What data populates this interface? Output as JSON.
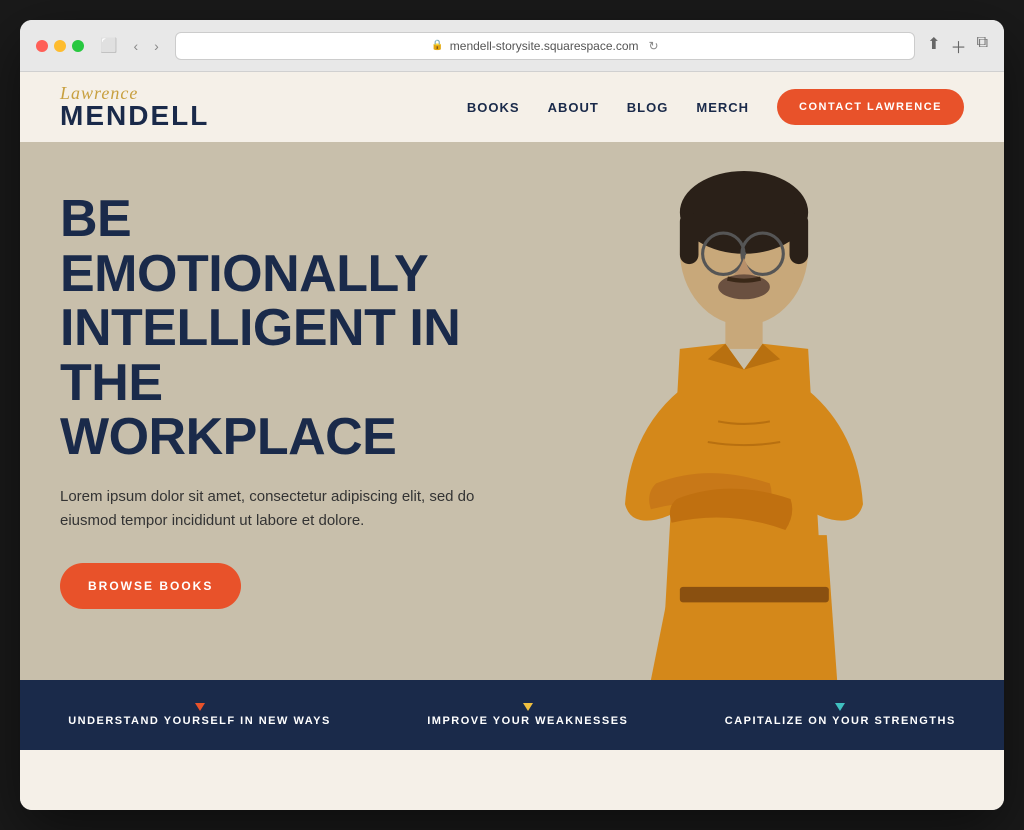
{
  "browser": {
    "url": "mendell-storysite.squarespace.com",
    "reload_icon": "↻"
  },
  "navbar": {
    "logo_script": "Lawrence",
    "logo_bold": "MENDELL",
    "nav_items": [
      {
        "label": "BOOKS",
        "id": "books"
      },
      {
        "label": "ABOUT",
        "id": "about"
      },
      {
        "label": "BLOG",
        "id": "blog"
      },
      {
        "label": "MERCH",
        "id": "merch"
      }
    ],
    "cta_label": "CONTACT LAWRENCE"
  },
  "hero": {
    "headline_line1": "BE EMOTIONALLY",
    "headline_line2": "INTELLIGENT IN",
    "headline_line3": "THE WORKPLACE",
    "subtext": "Lorem ipsum dolor sit amet, consectetur adipiscing elit, sed do eiusmod tempor incididunt ut labore et dolore.",
    "button_label": "BROWSE BOOKS"
  },
  "banner": {
    "items": [
      {
        "text": "UNDERSTAND YOURSELF IN NEW WAYS",
        "dot_color": "orange"
      },
      {
        "text": "IMPROVE YOUR WEAKNESSES",
        "dot_color": "yellow"
      },
      {
        "text": "CAPITALIZE ON YOUR STRENGTHS",
        "dot_color": "teal"
      }
    ]
  }
}
